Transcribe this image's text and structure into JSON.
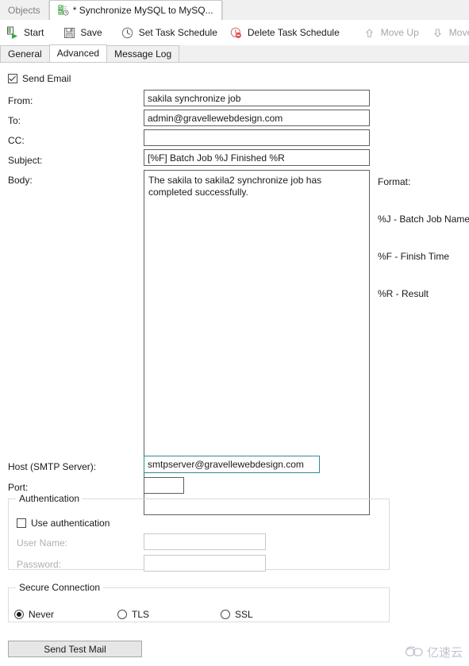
{
  "window": {
    "doc_tabs": [
      {
        "label": "Objects",
        "active": false,
        "icon": ""
      },
      {
        "label": "* Synchronize MySQL to MySQ...",
        "active": true,
        "icon": "sync-task-icon"
      }
    ]
  },
  "toolbar": {
    "buttons": [
      {
        "label": "Start",
        "icon": "start-icon",
        "disabled": false
      },
      {
        "label": "Save",
        "icon": "save-icon",
        "disabled": false
      },
      {
        "label": "Set Task Schedule",
        "icon": "clock-icon",
        "disabled": false
      },
      {
        "label": "Delete Task Schedule",
        "icon": "delete-schedule-icon",
        "disabled": false
      },
      {
        "label": "Move Up",
        "icon": "arrow-up-icon",
        "disabled": true
      },
      {
        "label": "Move Down",
        "icon": "arrow-down-icon",
        "disabled": true
      }
    ]
  },
  "inner_tabs": [
    {
      "label": "General",
      "active": false
    },
    {
      "label": "Advanced",
      "active": true
    },
    {
      "label": "Message Log",
      "active": false
    }
  ],
  "email": {
    "send_email_label": "Send Email",
    "send_email_checked": true,
    "from_label": "From:",
    "from_value": "sakila synchronize job",
    "to_label": "To:",
    "to_value": "admin@gravellewebdesign.com",
    "cc_label": "CC:",
    "cc_value": "",
    "subject_label": "Subject:",
    "subject_value": "[%F] Batch Job %J Finished %R",
    "body_label": "Body:",
    "body_value": "The sakila to sakila2 synchronize job has completed successfully.",
    "format_title": "Format:",
    "format_lines": [
      "%J - Batch Job Name",
      "%F - Finish Time",
      "%R - Result"
    ]
  },
  "server": {
    "host_label": "Host (SMTP Server):",
    "host_value": "smtpserver@gravellewebdesign.com",
    "port_label": "Port:",
    "port_value": ""
  },
  "authentication": {
    "group_title": "Authentication",
    "use_auth_label": "Use authentication",
    "use_auth_checked": false,
    "username_label": "User Name:",
    "username_value": "",
    "password_label": "Password:",
    "password_value": ""
  },
  "secure_connection": {
    "group_title": "Secure Connection",
    "options": [
      {
        "label": "Never",
        "selected": true
      },
      {
        "label": "TLS",
        "selected": false
      },
      {
        "label": "SSL",
        "selected": false
      }
    ]
  },
  "actions": {
    "send_test_mail_label": "Send Test Mail"
  },
  "watermark": {
    "text": "亿速云",
    "icon": "cloud-icon"
  },
  "colors": {
    "accent_focus": "#2e8b9a",
    "toolbar_green": "#2eac35",
    "toolbar_red": "#e05050",
    "chrome_bg": "#f0f0f0",
    "field_border": "#5f5f5f",
    "disabled_text": "#b0b0b0"
  }
}
